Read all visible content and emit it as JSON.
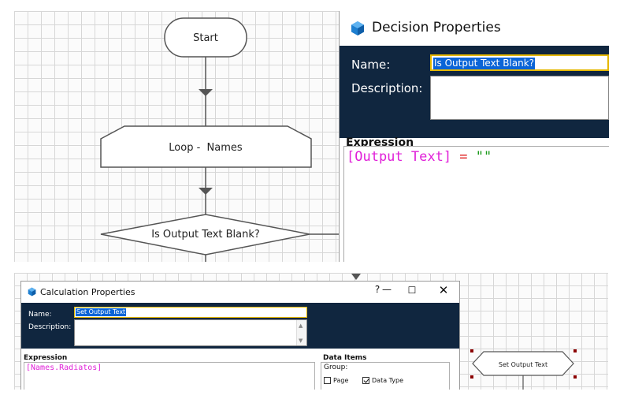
{
  "flowchart_top": {
    "start_label": "Start",
    "loop_label": "Loop -  Names",
    "decision_label": "Is Output Text Blank?"
  },
  "decision_properties": {
    "title": "Decision Properties",
    "name_label": "Name:",
    "name_value": "Is Output Text Blank?",
    "description_label": "Description:",
    "description_value": "",
    "expression_heading": "Expression",
    "expression_tokens": {
      "field": "[Output Text]",
      "operator": " = ",
      "string": "\"\""
    }
  },
  "calculation_properties": {
    "title": "Calculation Properties",
    "help_button": "?",
    "minimize_button": "—",
    "maximize_button": "☐",
    "close_button": "✕",
    "name_label": "Name:",
    "name_value": "Set Output Text",
    "description_label": "Description:",
    "description_value": "",
    "expression_heading": "Expression",
    "expression_text": "[Names.Radiatos]",
    "data_items_heading": "Data Items",
    "group_label": "Group:",
    "checkboxes": [
      {
        "label": "Page",
        "checked": false
      },
      {
        "label": "Data Type",
        "checked": true
      }
    ]
  },
  "flowchart_bottom": {
    "stage_label": "Set Output Text"
  },
  "icons": {
    "title_icon": "blueprism-cube-icon",
    "connector_arrow": "triangle-down-icon"
  },
  "colors": {
    "header_navy": "#10263f",
    "selection_blue": "#0a64d7",
    "focus_yellow": "#e6b800",
    "field_magenta": "#e020d8",
    "operator_red": "#e02020",
    "string_green": "#1a9a1a"
  }
}
